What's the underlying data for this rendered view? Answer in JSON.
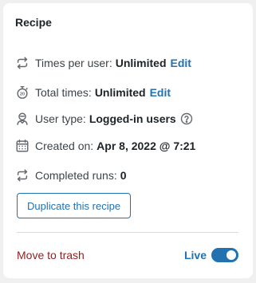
{
  "card": {
    "title": "Recipe"
  },
  "rows": {
    "times_per_user": {
      "label": "Times per user:",
      "value": "Unlimited",
      "edit": "Edit",
      "icon": "repeat-icon"
    },
    "total_times": {
      "label": "Total times:",
      "value": "Unlimited",
      "edit": "Edit",
      "icon": "stopwatch-icon"
    },
    "user_type": {
      "label": "User type:",
      "value": "Logged-in users",
      "icon": "user-icon",
      "help_icon": "help-icon"
    },
    "created_on": {
      "label": "Created on:",
      "value": "Apr 8, 2022 @ 7:21",
      "icon": "calendar-icon"
    },
    "completed_runs": {
      "label": "Completed runs:",
      "value": "0",
      "icon": "repeat-icon"
    }
  },
  "actions": {
    "duplicate_label": "Duplicate this recipe",
    "trash_label": "Move to trash",
    "live_label": "Live",
    "live_enabled": true
  },
  "colors": {
    "accent": "#2271b1",
    "trash": "#8a2424",
    "text": "#3c434a",
    "icon": "#646970"
  }
}
